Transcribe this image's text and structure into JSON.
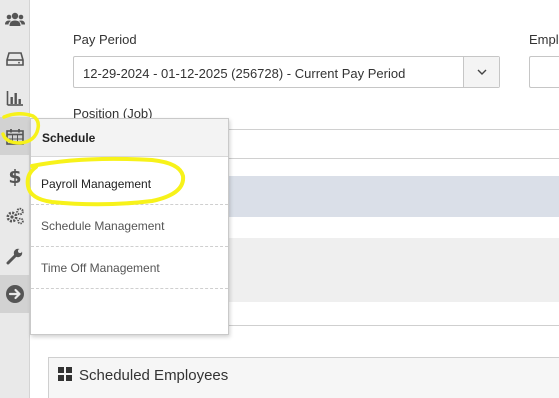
{
  "sidebar": {
    "icons": [
      "users-icon",
      "inbox-icon",
      "bar-chart-icon",
      "calendar-icon",
      "dollar-icon",
      "gears-icon",
      "wrench-icon",
      "arrow-right-circle-icon"
    ]
  },
  "form": {
    "pay_period_label": "Pay Period",
    "pay_period_value": "12-29-2024 - 01-12-2025 (256728) - Current Pay Period",
    "employee_label": "Empl",
    "position_label": "Position (Job)"
  },
  "panel": {
    "title": "Scheduled Employees"
  },
  "flyout": {
    "header": "Schedule",
    "items": [
      {
        "label": "Payroll Management"
      },
      {
        "label": "Schedule Management"
      },
      {
        "label": "Time Off Management"
      }
    ]
  },
  "colors": {
    "highlight": "#f7f21a",
    "band_blue": "#dadfe8"
  }
}
